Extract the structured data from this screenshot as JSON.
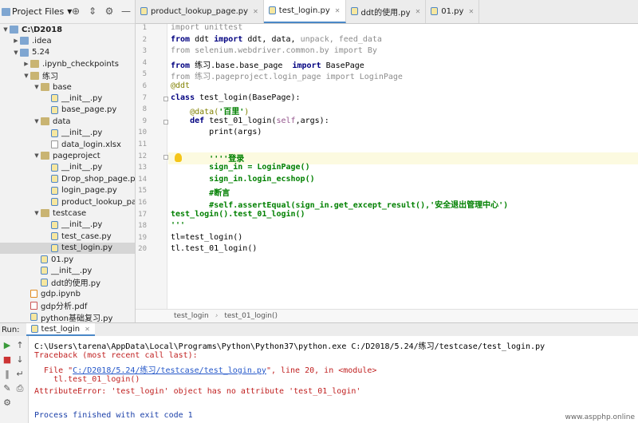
{
  "project_panel": {
    "title": "Project Files",
    "tools": [
      "crosshair-icon",
      "collapse-icon",
      "gear-icon",
      "hide-icon"
    ],
    "tree": [
      {
        "label": "C:\\D2018",
        "depth": 0,
        "expanded": true,
        "kind": "folder",
        "bold": true
      },
      {
        "label": ".idea",
        "depth": 1,
        "expanded": false,
        "kind": "folder"
      },
      {
        "label": "5.24",
        "depth": 1,
        "expanded": true,
        "kind": "folder"
      },
      {
        "label": ".ipynb_checkpoints",
        "depth": 2,
        "expanded": false,
        "kind": "folder"
      },
      {
        "label": "练习",
        "depth": 2,
        "expanded": true,
        "kind": "folder"
      },
      {
        "label": "base",
        "depth": 3,
        "expanded": true,
        "kind": "folder"
      },
      {
        "label": "__init__.py",
        "depth": 4,
        "kind": "py"
      },
      {
        "label": "base_page.py",
        "depth": 4,
        "kind": "py"
      },
      {
        "label": "data",
        "depth": 3,
        "expanded": true,
        "kind": "folder"
      },
      {
        "label": "__init__.py",
        "depth": 4,
        "kind": "py"
      },
      {
        "label": "data_login.xlsx",
        "depth": 4,
        "kind": "gen"
      },
      {
        "label": "pageproject",
        "depth": 3,
        "expanded": true,
        "kind": "folder"
      },
      {
        "label": "__init__.py",
        "depth": 4,
        "kind": "py"
      },
      {
        "label": "Drop_shop_page.py",
        "depth": 4,
        "kind": "py"
      },
      {
        "label": "login_page.py",
        "depth": 4,
        "kind": "py"
      },
      {
        "label": "product_lookup_page.py",
        "depth": 4,
        "kind": "py"
      },
      {
        "label": "testcase",
        "depth": 3,
        "expanded": true,
        "kind": "folder"
      },
      {
        "label": "__init__.py",
        "depth": 4,
        "kind": "py"
      },
      {
        "label": "test_case.py",
        "depth": 4,
        "kind": "py"
      },
      {
        "label": "test_login.py",
        "depth": 4,
        "kind": "py",
        "selected": true
      },
      {
        "label": "01.py",
        "depth": 3,
        "kind": "py"
      },
      {
        "label": "__init__.py",
        "depth": 3,
        "kind": "py"
      },
      {
        "label": "ddt的使用.py",
        "depth": 3,
        "kind": "py"
      },
      {
        "label": "gdp.ipynb",
        "depth": 2,
        "kind": "nb"
      },
      {
        "label": "gdp分析.pdf",
        "depth": 2,
        "kind": "pdf"
      },
      {
        "label": "python基础复习.py",
        "depth": 2,
        "kind": "py"
      }
    ]
  },
  "editor": {
    "tabs": [
      {
        "label": "product_lookup_page.py",
        "active": false
      },
      {
        "label": "test_login.py",
        "active": true
      },
      {
        "label": "ddt的使用.py",
        "active": false
      },
      {
        "label": "01.py",
        "active": false
      }
    ],
    "lines": [
      [
        {
          "t": "import unittest",
          "c": "grey"
        }
      ],
      [
        {
          "t": "from ",
          "c": "kw"
        },
        {
          "t": "ddt ",
          "c": "fn"
        },
        {
          "t": "import ",
          "c": "kw"
        },
        {
          "t": "ddt, data, ",
          "c": "fn"
        },
        {
          "t": "unpack, feed_data",
          "c": "grey"
        }
      ],
      [
        {
          "t": "from selenium.webdriver.common.by import By",
          "c": "grey"
        }
      ],
      [
        {
          "t": "from ",
          "c": "kw"
        },
        {
          "t": "练习.base.base_page  ",
          "c": "fn"
        },
        {
          "t": "import ",
          "c": "kw"
        },
        {
          "t": "BasePage",
          "c": "fn"
        }
      ],
      [
        {
          "t": "from 练习.pageproject.login_page import LoginPage",
          "c": "grey"
        }
      ],
      [
        {
          "t": "@ddt",
          "c": "deco"
        }
      ],
      [
        {
          "t": "class ",
          "c": "kw"
        },
        {
          "t": "test_login(BasePage):",
          "c": "fn"
        }
      ],
      [
        {
          "t": "    ",
          "c": "fn"
        },
        {
          "t": "@data(",
          "c": "deco"
        },
        {
          "t": "'百里'",
          "c": "str"
        },
        {
          "t": ")",
          "c": "deco"
        }
      ],
      [
        {
          "t": "    ",
          "c": "fn"
        },
        {
          "t": "def ",
          "c": "kw"
        },
        {
          "t": "test_01_login(",
          "c": "fn"
        },
        {
          "t": "self",
          "c": "self"
        },
        {
          "t": ",args):",
          "c": "fn"
        }
      ],
      [
        {
          "t": "        print(args)",
          "c": "fn"
        }
      ],
      [
        {
          "t": "",
          "c": "fn"
        }
      ],
      [
        {
          "t": "        ",
          "c": "fn"
        },
        {
          "t": "''''登录",
          "c": "str"
        }
      ],
      [
        {
          "t": "        ",
          "c": "fn"
        },
        {
          "t": "sign_in = LoginPage()",
          "c": "str"
        }
      ],
      [
        {
          "t": "        ",
          "c": "fn"
        },
        {
          "t": "sign_in.login_ecshop()",
          "c": "str"
        }
      ],
      [
        {
          "t": "        ",
          "c": "fn"
        },
        {
          "t": "#断言",
          "c": "str"
        }
      ],
      [
        {
          "t": "        ",
          "c": "fn"
        },
        {
          "t": "#self.assertEqual(sign_in.get_except_result(),'安全退出管理中心')",
          "c": "str"
        }
      ],
      [
        {
          "t": "test_login().test_01_login()",
          "c": "str"
        }
      ],
      [
        {
          "t": "'''",
          "c": "str"
        }
      ],
      [
        {
          "t": "tl=test_login()",
          "c": "fn"
        }
      ],
      [
        {
          "t": "tl.test_01_login()",
          "c": "fn"
        }
      ]
    ],
    "line_numbers": [
      "1",
      "2",
      "3",
      "4",
      "5",
      "6",
      "7",
      "8",
      "9",
      "10",
      "11",
      "12",
      "13",
      "14",
      "15",
      "16",
      "17",
      "18",
      "19",
      "20"
    ],
    "breadcrumb": [
      "test_login",
      "test_01_login()"
    ]
  },
  "run": {
    "label": "Run:",
    "tab": "test_login",
    "toolbar_icons": [
      "rerun-icon",
      "up-icon",
      "stop-icon",
      "down-icon",
      "wrap-icon",
      "pin-icon",
      "print-icon"
    ],
    "console": {
      "command": "C:\\Users\\tarena\\AppData\\Local\\Programs\\Python\\Python37\\python.exe C:/D2018/5.24/练习/testcase/test_login.py",
      "traceback": "Traceback (most recent call last):",
      "file_prefix": "  File \"",
      "file_link": "C:/D2018/5.24/练习/testcase/test_login.py",
      "file_suffix": "\", line 20, in <module>",
      "code_line": "    tl.test_01_login()",
      "error": "AttributeError: 'test_login' object has no attribute 'test_01_login'",
      "finished": "Process finished with exit code 1"
    },
    "watermark": "www.aspphp.online"
  }
}
